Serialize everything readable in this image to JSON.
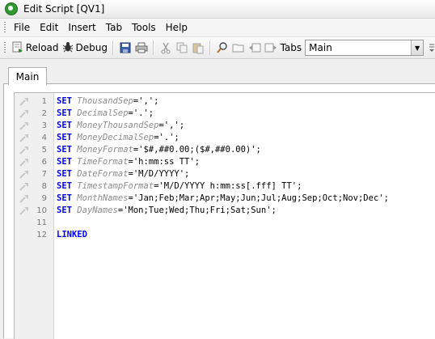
{
  "window": {
    "title": "Edit Script [QV1]"
  },
  "menu": [
    "File",
    "Edit",
    "Insert",
    "Tab",
    "Tools",
    "Help"
  ],
  "toolbar": {
    "reload_label": "Reload",
    "debug_label": "Debug",
    "tabs_label": "Tabs",
    "tabs_selected": "Main",
    "icons": [
      "save-icon",
      "print-icon",
      "cut-icon",
      "copy-icon",
      "paste-icon",
      "find-icon",
      "open-icon",
      "tab-left-icon",
      "tab-right-icon"
    ]
  },
  "tab": {
    "label": "Main"
  },
  "script": [
    {
      "num": "1",
      "kw": "SET",
      "var": "ThousandSep",
      "rest": "=',';"
    },
    {
      "num": "2",
      "kw": "SET",
      "var": "DecimalSep",
      "rest": "='.';"
    },
    {
      "num": "3",
      "kw": "SET",
      "var": "MoneyThousandSep",
      "rest": "=',';"
    },
    {
      "num": "4",
      "kw": "SET",
      "var": "MoneyDecimalSep",
      "rest": "='.';"
    },
    {
      "num": "5",
      "kw": "SET",
      "var": "MoneyFormat",
      "rest": "='$#,##0.00;($#,##0.00)';"
    },
    {
      "num": "6",
      "kw": "SET",
      "var": "TimeFormat",
      "rest": "='h:mm:ss TT';"
    },
    {
      "num": "7",
      "kw": "SET",
      "var": "DateFormat",
      "rest": "='M/D/YYYY';"
    },
    {
      "num": "8",
      "kw": "SET",
      "var": "TimestampFormat",
      "rest": "='M/D/YYYY h:mm:ss[.fff] TT';"
    },
    {
      "num": "9",
      "kw": "SET",
      "var": "MonthNames",
      "rest": "='Jan;Feb;Mar;Apr;May;Jun;Jul;Aug;Sep;Oct;Nov;Dec';"
    },
    {
      "num": "10",
      "kw": "SET",
      "var": "DayNames",
      "rest": "='Mon;Tue;Wed;Thu;Fri;Sat;Sun';"
    },
    {
      "num": "11",
      "kw": "",
      "var": "",
      "rest": ""
    },
    {
      "num": "12",
      "kw": "LINKED",
      "var": "",
      "rest": ""
    }
  ],
  "colors": {
    "keyword": "#0000ff",
    "variable": "#8c8c8c"
  }
}
